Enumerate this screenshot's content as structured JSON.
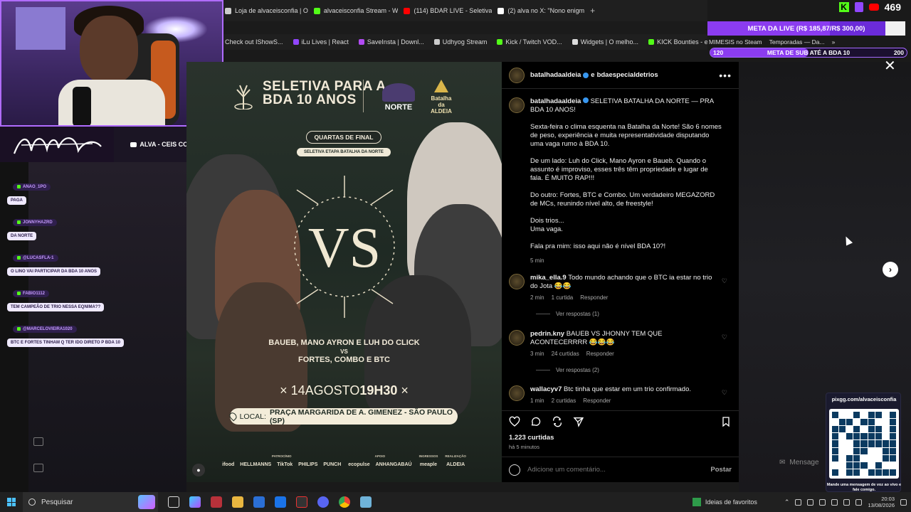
{
  "browser": {
    "tabs": [
      {
        "label": "Loja de alvaceisconfia | O",
        "color": "#cccccc"
      },
      {
        "label": "alvaceisconfia Stream - W",
        "color": "#53fc18"
      },
      {
        "label": "(114) BDAR LIVE - Seletiva",
        "color": "#ff0000"
      },
      {
        "label": "(2) alva no X: \"Nono enigm",
        "color": "#ffffff"
      }
    ],
    "new_tab": "+",
    "bookmarks": [
      {
        "label": "Check out IShowS...",
        "color": ""
      },
      {
        "label": "iLu Lives | React",
        "color": "#9146ff"
      },
      {
        "label": "SaveInsta | Downl...",
        "color": "#b24bf3"
      },
      {
        "label": "Udhyog Stream",
        "color": "#cccccc"
      },
      {
        "label": "Kick / Twitch VOD...",
        "color": "#53fc18"
      },
      {
        "label": "Widgets | O melho...",
        "color": "#dddddd"
      },
      {
        "label": "KICK Bounties - ev...",
        "color": "#53fc18"
      }
    ],
    "bookmarks_right": [
      {
        "label": "MIMESIS no Steam"
      },
      {
        "label": "Temporadas — Da..."
      },
      {
        "label": "»"
      }
    ]
  },
  "stream_overlay": {
    "viewers": "469",
    "meta_live": {
      "label": "META DA LIVE (R$ 185,87/R$ 300,00)",
      "progress": 0.62
    },
    "meta_sub": {
      "start": "120",
      "label": "META DE SUB ATÉ A BDA 10",
      "end": "200",
      "progress": 0.5
    },
    "channel_label": "ALVA - CEIS CONFIA?",
    "chat": [
      {
        "user": "ANAO_1PO",
        "text": "PAGA"
      },
      {
        "user": "JONNYHAZRD",
        "text": "DA NORTE"
      },
      {
        "user": "@LUCASFLA-1",
        "text": "O LINO VAI PARTICIPAR DA BDA 10 ANOS"
      },
      {
        "user": "FABIO1112",
        "text": "TEM CAMPEÃO DE TRIO NESSA EQNIMA??"
      },
      {
        "user": "@MARCELOVIEIRA1020",
        "text": "BTC E FORTES TINHAM Q TER IDO DIRETO P BDA 10"
      }
    ],
    "pix": {
      "url": "pixgg.com/alvaceisconfia",
      "message": "Mande uma mensagem de voz ao vivo e fale comigo."
    }
  },
  "post_image": {
    "title_line1": "SELETIVA PARA A",
    "title_line2": "BDA 10 ANOS",
    "norte_label": "NORTE",
    "aldeia_label": "Batalha da ALDEIA",
    "stage": "QUARTAS DE FINAL",
    "subtitle": "SELETIVA ETAPA BATALHA DA NORTE",
    "vs": "VS",
    "team1": "BAUEB, MANO AYRON E LUH DO CLICK",
    "vs_small": "VS",
    "team2": "FORTES, COMBO E BTC",
    "date_day": "14AGOSTO",
    "date_time": "19H30",
    "local_label": "LOCAL:",
    "local_value": "PRAÇA MARGARIDA DE A. GIMENEZ - SÃO PAULO (SP)",
    "sponsor_labels": [
      "PATROCÍNIO",
      "APOIO",
      "INGRESSOS",
      "REALIZAÇÃO"
    ],
    "sponsors": [
      "ifood",
      "HELLMANNS",
      "TikTok",
      "PHILIPS",
      "PUNCH",
      "ecopulse",
      "ANHANGABAÚ",
      "meaple",
      "ALDEIA"
    ]
  },
  "instagram": {
    "header_user": "batalhadaaldeia",
    "header_and": "e",
    "header_collab": "bdaespecialdetrios",
    "more": "•••",
    "caption_user": "batalhadaaldeia",
    "caption_lines": [
      "SELETIVA BATALHA DA NORTE — PRA BDA 10 ANOS!",
      "Sexta-feira o clima esquenta na Batalha da Norte! São 6 nomes de peso, experiência e muita representatividade disputando uma vaga rumo à BDA 10.",
      "De um lado: Luh do Click, Mano Ayron e Baueb. Quando o assunto é improviso, esses três têm propriedade e lugar de fala. É MUITO RAP!!!",
      "Do outro: Fortes, BTC e Combo. Um verdadeiro MEGAZORD de MCs, reunindo nível alto, de freestyle!",
      "Dois trios...\nUma vaga.",
      "Fala pra mim: isso aqui não é nível BDA 10?!"
    ],
    "caption_time": "5 min",
    "comments": [
      {
        "user": "mika_ella.9",
        "text": "Todo mundo achando que o BTC ia estar no trio do Jota 😂😂",
        "time": "2 min",
        "likes": "1 curtida",
        "reply": "Responder",
        "replies": "Ver respostas (1)"
      },
      {
        "user": "pedrin.kny",
        "text": "BAUEB VS JHONNY TEM QUE ACONTECERRRR 😂😂😂",
        "time": "3 min",
        "likes": "24 curtidas",
        "reply": "Responder",
        "replies": "Ver respostas (2)"
      },
      {
        "user": "wallacyv7",
        "text": "Btc tinha que estar em um trio confirmado.",
        "time": "1 min",
        "likes": "2 curtidas",
        "reply": "Responder",
        "replies": ""
      }
    ],
    "likes_count": "1.223 curtidas",
    "posted_ago": "há 5 minutos",
    "comment_placeholder": "Adicione um comentário...",
    "post_button": "Postar"
  },
  "right_side": {
    "close": "✕",
    "next": "›",
    "message_label": "Mensage"
  },
  "taskbar": {
    "search_placeholder": "Pesquisar",
    "news": "Ideias de favoritos",
    "time": "20:03",
    "date": "13/08/2026"
  }
}
